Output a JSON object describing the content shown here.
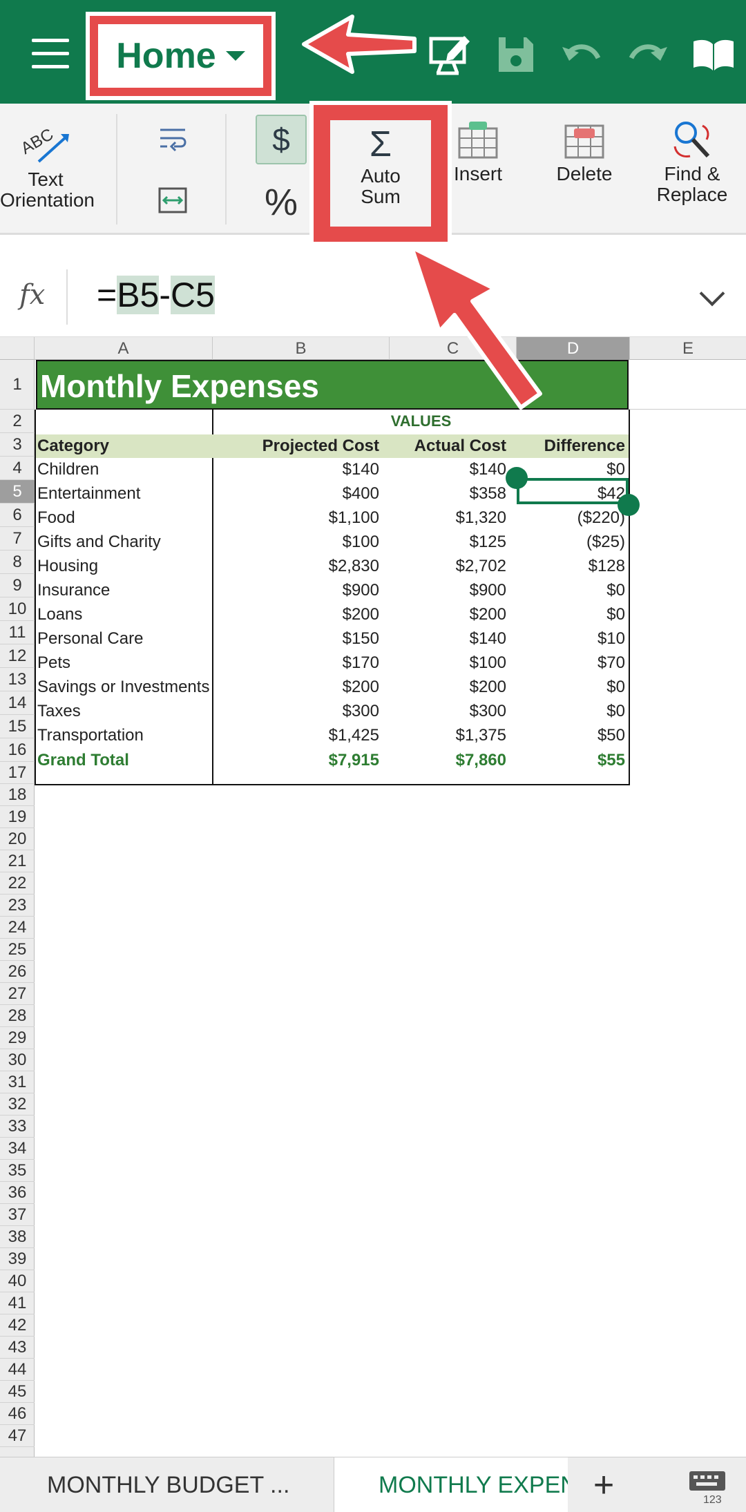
{
  "appbar": {
    "home_label": "Home",
    "icons": [
      "menu-icon",
      "present-edit-icon",
      "save-icon",
      "undo-icon",
      "redo-icon",
      "read-mode-icon"
    ],
    "color": "#107a4d"
  },
  "ribbon": {
    "text_orientation": [
      "Text",
      "Orientation"
    ],
    "autosum": [
      "Auto",
      "Sum"
    ],
    "autosum_symbol": "Σ",
    "currency_symbol": "$",
    "percent_symbol": "%",
    "insert": "Insert",
    "delete": "Delete",
    "find_replace": [
      "Find &",
      "Replace"
    ]
  },
  "formula_bar": {
    "fx": "fx",
    "eq": "=",
    "ref1": "B5",
    "minus": "-",
    "ref2": "C5"
  },
  "columns": [
    "A",
    "B",
    "C",
    "D",
    "E"
  ],
  "selected_column": "D",
  "selected_row": 5,
  "rows": [
    "1",
    "2",
    "3",
    "4",
    "5",
    "6",
    "7",
    "8",
    "9",
    "10",
    "11",
    "12",
    "13",
    "14",
    "15",
    "16",
    "17",
    "18",
    "19",
    "20",
    "21",
    "22",
    "23",
    "24",
    "25",
    "26",
    "27",
    "28",
    "29",
    "30",
    "31",
    "32",
    "33",
    "34",
    "35",
    "36",
    "37",
    "38",
    "39",
    "40",
    "41",
    "42",
    "43",
    "44",
    "45",
    "46",
    "47"
  ],
  "sheet": {
    "title": "Monthly Expenses",
    "values_header": "VALUES",
    "headers": {
      "category": "Category",
      "projected": "Projected Cost",
      "actual": "Actual Cost",
      "difference": "Difference"
    },
    "data": [
      {
        "cat": "Children",
        "b": "$140",
        "c": "$140",
        "d": "$0"
      },
      {
        "cat": "Entertainment",
        "b": "$400",
        "c": "$358",
        "d": "$42"
      },
      {
        "cat": "Food",
        "b": "$1,100",
        "c": "$1,320",
        "d": "($220)"
      },
      {
        "cat": "Gifts and Charity",
        "b": "$100",
        "c": "$125",
        "d": "($25)"
      },
      {
        "cat": "Housing",
        "b": "$2,830",
        "c": "$2,702",
        "d": "$128"
      },
      {
        "cat": "Insurance",
        "b": "$900",
        "c": "$900",
        "d": "$0"
      },
      {
        "cat": "Loans",
        "b": "$200",
        "c": "$200",
        "d": "$0"
      },
      {
        "cat": "Personal Care",
        "b": "$150",
        "c": "$140",
        "d": "$10"
      },
      {
        "cat": "Pets",
        "b": "$170",
        "c": "$100",
        "d": "$70"
      },
      {
        "cat": "Savings or Investments",
        "b": "$200",
        "c": "$200",
        "d": "$0"
      },
      {
        "cat": "Taxes",
        "b": "$300",
        "c": "$300",
        "d": "$0"
      },
      {
        "cat": "Transportation",
        "b": "$1,425",
        "c": "$1,375",
        "d": "$50"
      }
    ],
    "total": {
      "cat": "Grand Total",
      "b": "$7,915",
      "c": "$7,860",
      "d": "$55"
    }
  },
  "tabs": {
    "tab1": "MONTHLY BUDGET ...",
    "tab2": "MONTHLY EXPENSES",
    "add": "+"
  }
}
